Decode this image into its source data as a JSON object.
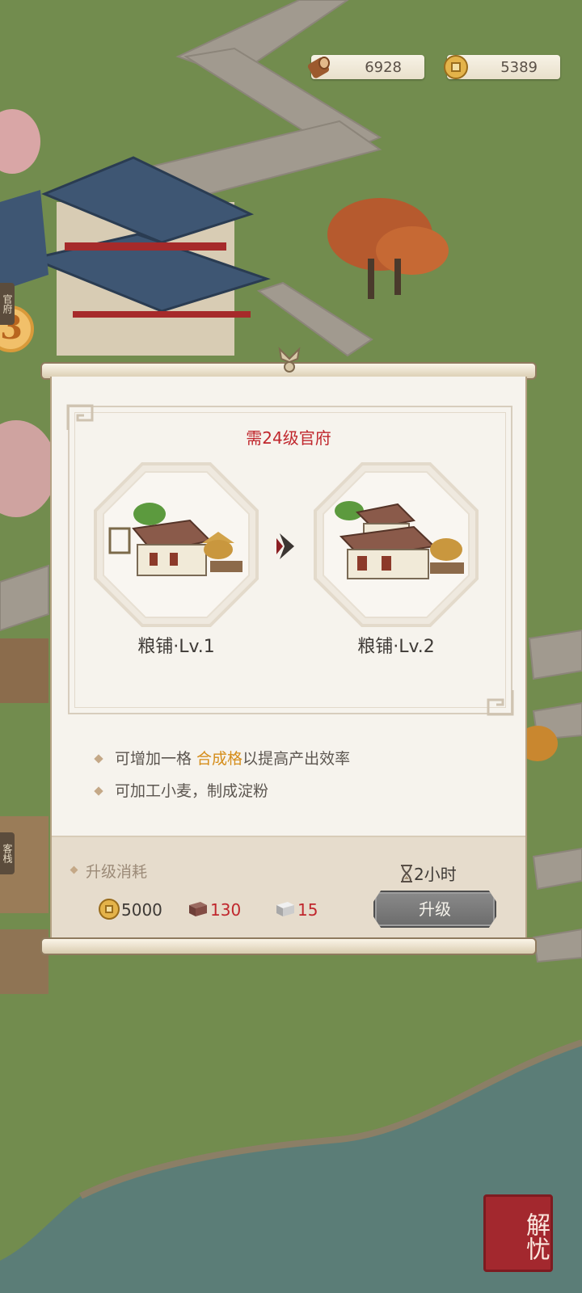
{
  "resources": {
    "wood": {
      "icon": "wood-log-icon",
      "value": "6928"
    },
    "coin": {
      "icon": "copper-coin-icon",
      "value": "5389"
    }
  },
  "side_tabs": {
    "guanfu": "官府",
    "guanfu_badge": "3",
    "kezhan": "客栈"
  },
  "dialog": {
    "requirement": "需24级官府",
    "current": {
      "name": "粮铺·Lv.1"
    },
    "next": {
      "name": "粮铺·Lv.2"
    },
    "perks": [
      {
        "before": "可增加一格 ",
        "highlight": "合成格",
        "after": "以提高产出效率"
      },
      {
        "before": "可加工小麦，制成淀粉",
        "highlight": "",
        "after": ""
      }
    ],
    "cost": {
      "title": "升级消耗",
      "time": "2小时",
      "items": [
        {
          "icon": "copper-coin-icon",
          "value": "5000"
        },
        {
          "icon": "brick-icon",
          "value": "130"
        },
        {
          "icon": "stone-block-icon",
          "value": "15"
        }
      ]
    },
    "upgrade_label": "升级"
  },
  "seal": "解忧",
  "colors": {
    "requirement": "#c0272d",
    "highlight": "#d58d1a",
    "grass": "#6f8a4c",
    "water": "#587c76"
  }
}
